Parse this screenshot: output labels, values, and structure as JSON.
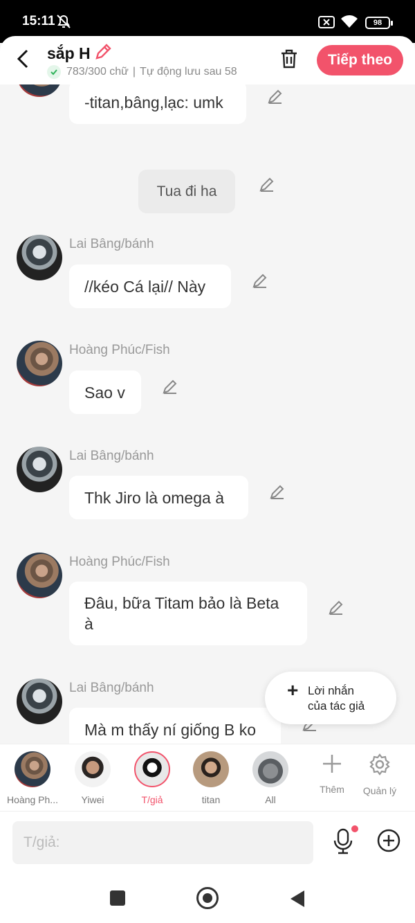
{
  "status": {
    "time": "15:11",
    "battery": "98"
  },
  "header": {
    "title": "sắp H",
    "word_count": "783/300 chữ",
    "autosave": "Tự động lưu sau 58",
    "next_label": "Tiếp theo"
  },
  "messages": [
    {
      "sender": "",
      "text": "-titan,bâng,lạc: umk"
    },
    {
      "sender": "",
      "text": "Tua đi ha"
    },
    {
      "sender": "Lai Bâng/bánh",
      "text": "//kéo Cá lại// Này"
    },
    {
      "sender": "Hoàng Phúc/Fish",
      "text": "Sao v"
    },
    {
      "sender": "Lai Bâng/bánh",
      "text": "Thk Jiro là omega à"
    },
    {
      "sender": "Hoàng Phúc/Fish",
      "text": "Đâu, bữa Titam bảo là Beta à"
    },
    {
      "sender": "Lai Bâng/bánh",
      "text": "Mà m thấy ní giống B ko"
    }
  ],
  "float_note": {
    "line1": "Lời nhắn",
    "line2": "của tác giả"
  },
  "characters": [
    {
      "name": "Hoàng Ph..."
    },
    {
      "name": "Yiwei"
    },
    {
      "name": "T/giả"
    },
    {
      "name": "titan"
    },
    {
      "name": "All"
    }
  ],
  "tools": {
    "add": "Thêm",
    "manage": "Quản lý"
  },
  "input": {
    "placeholder": "T/giả:"
  },
  "icons": [
    "back-icon",
    "pencil-icon",
    "trash-icon",
    "check-icon",
    "plus-icon",
    "gear-icon",
    "mic-icon",
    "plus-circle-icon"
  ],
  "colors": {
    "accent": "#f2536b",
    "background": "#f5f5f5"
  }
}
